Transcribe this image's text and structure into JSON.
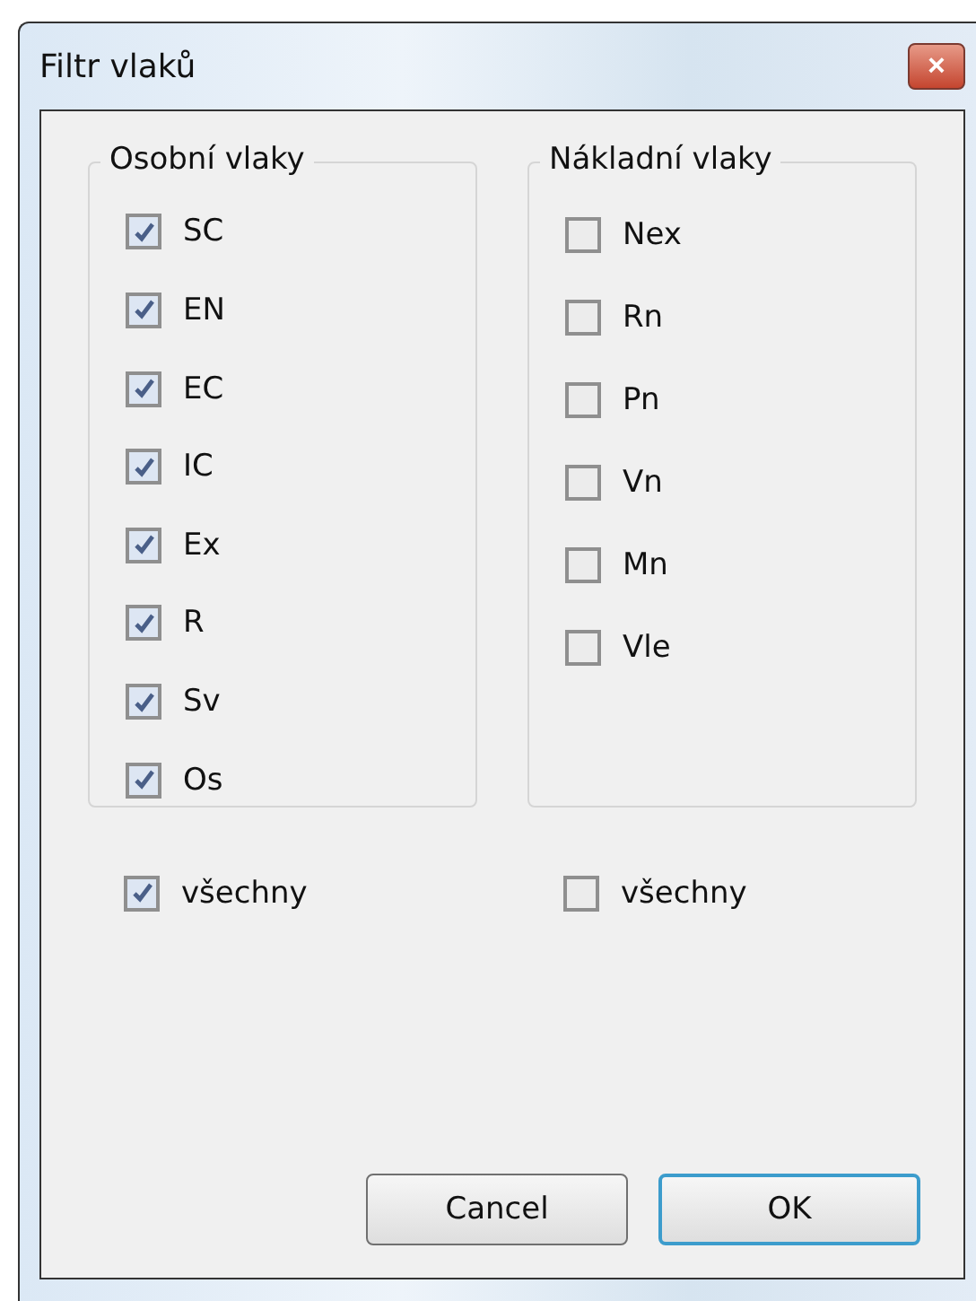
{
  "window": {
    "title": "Filtr vlaků",
    "close": "×"
  },
  "groups": [
    {
      "title": "Osobní vlaky",
      "items": [
        {
          "label": "SC",
          "checked": true
        },
        {
          "label": "EN",
          "checked": true
        },
        {
          "label": "EC",
          "checked": true
        },
        {
          "label": "IC",
          "checked": true
        },
        {
          "label": "Ex",
          "checked": true
        },
        {
          "label": "R",
          "checked": true
        },
        {
          "label": "Sv",
          "checked": true
        },
        {
          "label": "Os",
          "checked": true
        }
      ],
      "all": {
        "label": "všechny",
        "checked": true
      }
    },
    {
      "title": "Nákladní vlaky",
      "items": [
        {
          "label": "Nex",
          "checked": false
        },
        {
          "label": "Rn",
          "checked": false
        },
        {
          "label": "Pn",
          "checked": false
        },
        {
          "label": "Vn",
          "checked": false
        },
        {
          "label": "Mn",
          "checked": false
        },
        {
          "label": "Vle",
          "checked": false
        }
      ],
      "all": {
        "label": "všechny",
        "checked": false
      }
    }
  ],
  "buttons": [
    {
      "label": "Cancel",
      "default": false
    },
    {
      "label": "OK",
      "default": true
    }
  ]
}
